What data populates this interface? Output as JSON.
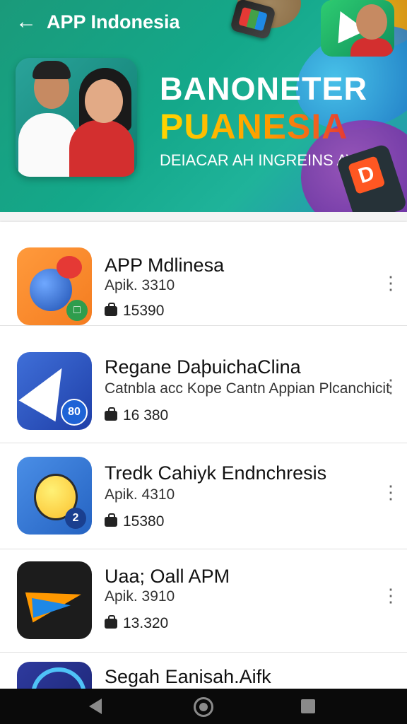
{
  "header": {
    "back_icon": "back-arrow-icon",
    "title": "APP Indonesia",
    "banner_line1": "BANONETER",
    "banner_line2": "PUANESIA",
    "banner_line3": "DEIACAR AH INGREINS AVI"
  },
  "apps": [
    {
      "name": "APP Mdlinesa",
      "subtitle": "Apik. 3310",
      "downloads": "15390",
      "icon": "app-icon-rocket-bear",
      "badge": ""
    },
    {
      "name": "Regane DaþuichaClina",
      "subtitle": "Catnbla acc Kope Cantn  Appian Plcanchicit",
      "downloads": "16 380",
      "icon": "app-icon-paper-plane",
      "badge": "80"
    },
    {
      "name": "Tredk Cahiyk Endnchresis",
      "subtitle": "Apik. 4310",
      "downloads": "15380",
      "icon": "app-icon-smiley",
      "badge": "2"
    },
    {
      "name": "Uaa; Oall APM",
      "subtitle": "Apik. 3910",
      "downloads": "13.320",
      "icon": "app-icon-colorful-plane",
      "badge": ""
    },
    {
      "name": "Segah Eanisah.Aifk",
      "subtitle": "",
      "downloads": "",
      "icon": "app-icon-ring",
      "badge": ""
    }
  ],
  "navbar": {
    "back": "nav-back-icon",
    "home": "nav-home-icon",
    "recents": "nav-recents-icon"
  }
}
